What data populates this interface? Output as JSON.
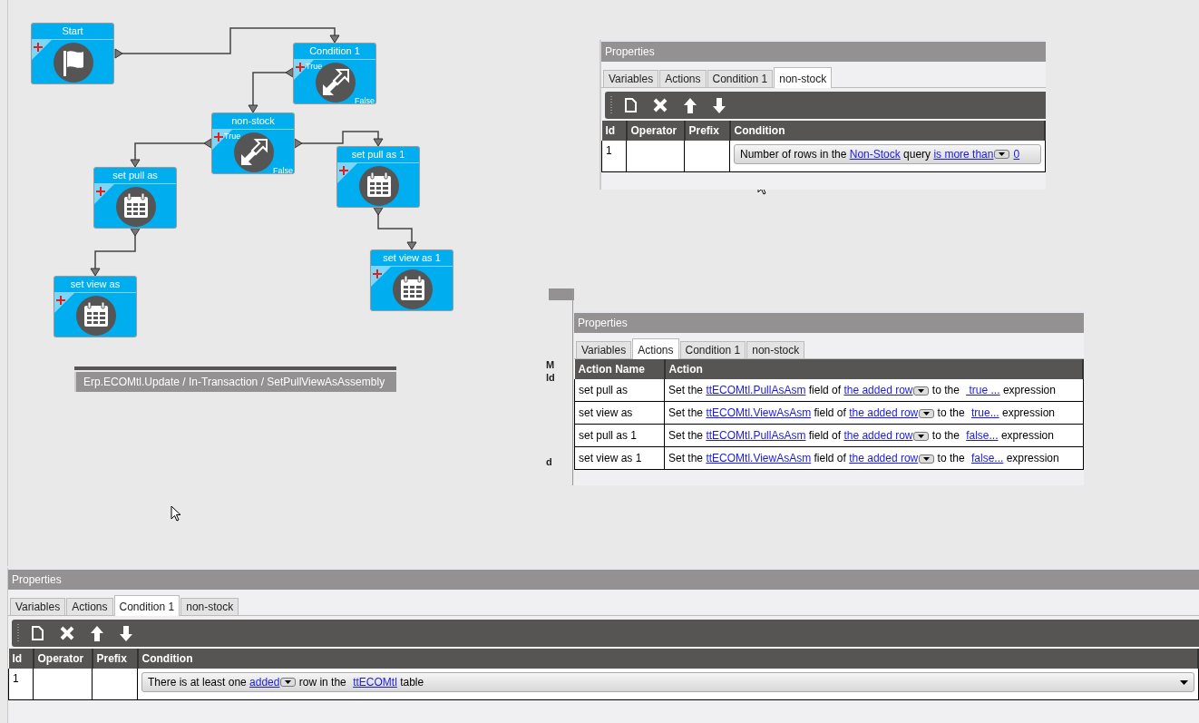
{
  "flow": {
    "nodes": [
      {
        "kind": "start",
        "title": "Start"
      },
      {
        "kind": "condition",
        "title": "Condition 1",
        "true_label": "True",
        "false_label": "False"
      },
      {
        "kind": "condition",
        "title": "non-stock",
        "true_label": "True",
        "false_label": "False"
      },
      {
        "kind": "action",
        "title": "set pull as"
      },
      {
        "kind": "action",
        "title": "set pull as 1"
      },
      {
        "kind": "action",
        "title": "set view as"
      },
      {
        "kind": "action",
        "title": "set view as 1"
      }
    ]
  },
  "breadcrumb": "Erp.ECOMtl.Update / In-Transaction / SetPullViewAsAssembly",
  "clipped_labels": [
    "M",
    "ld",
    "d"
  ],
  "panels": [
    {
      "kind": "condition",
      "title": "Properties",
      "tabs": [
        {
          "label": "Variables",
          "selected": false
        },
        {
          "label": "Actions",
          "selected": false
        },
        {
          "label": "Condition 1",
          "selected": false
        },
        {
          "label": "non-stock",
          "selected": true
        }
      ],
      "columns": [
        "Id",
        "Operator",
        "Prefix",
        "Condition"
      ],
      "rows": [
        {
          "id": "1",
          "segments": [
            {
              "kind": "text",
              "text": "Number of rows in the "
            },
            {
              "kind": "link",
              "text": "Non-Stock"
            },
            {
              "kind": "text",
              "text": " query "
            },
            {
              "kind": "link",
              "text": "is more than"
            },
            {
              "kind": "dropdown"
            },
            {
              "kind": "link",
              "text": "0"
            }
          ]
        }
      ]
    },
    {
      "kind": "actions",
      "title": "Properties",
      "tabs": [
        {
          "label": "Variables",
          "selected": false
        },
        {
          "label": "Actions",
          "selected": true
        },
        {
          "label": "Condition 1",
          "selected": false
        },
        {
          "label": "non-stock",
          "selected": false
        }
      ],
      "columns": [
        "Action Name",
        "Action"
      ],
      "rows": [
        {
          "name": "set pull as",
          "segments": [
            {
              "kind": "text",
              "text": "Set the "
            },
            {
              "kind": "link",
              "text": "ttECOMtl.PullAsAsm"
            },
            {
              "kind": "text",
              "text": " field of "
            },
            {
              "kind": "link",
              "text": "the added row"
            },
            {
              "kind": "dropdown"
            },
            {
              "kind": "text",
              "text": " to the "
            },
            {
              "kind": "link",
              "text": " true ..."
            },
            {
              "kind": "text",
              "text": " expression"
            }
          ]
        },
        {
          "name": "set view as",
          "segments": [
            {
              "kind": "text",
              "text": "Set the "
            },
            {
              "kind": "link",
              "text": "ttECOMtl.ViewAsAsm"
            },
            {
              "kind": "text",
              "text": " field of "
            },
            {
              "kind": "link",
              "text": "the added row"
            },
            {
              "kind": "dropdown"
            },
            {
              "kind": "text",
              "text": " to the "
            },
            {
              "kind": "link",
              "text": "true..."
            },
            {
              "kind": "text",
              "text": " expression"
            }
          ]
        },
        {
          "name": "set pull as 1",
          "segments": [
            {
              "kind": "text",
              "text": "Set the "
            },
            {
              "kind": "link",
              "text": "ttECOMtl.PullAsAsm"
            },
            {
              "kind": "text",
              "text": " field of "
            },
            {
              "kind": "link",
              "text": "the added row"
            },
            {
              "kind": "dropdown"
            },
            {
              "kind": "text",
              "text": " to the "
            },
            {
              "kind": "link",
              "text": "false..."
            },
            {
              "kind": "text",
              "text": " expression"
            }
          ]
        },
        {
          "name": "set view as 1",
          "segments": [
            {
              "kind": "text",
              "text": "Set the "
            },
            {
              "kind": "link",
              "text": "ttECOMtl.ViewAsAsm"
            },
            {
              "kind": "text",
              "text": " field of "
            },
            {
              "kind": "link",
              "text": "the added row"
            },
            {
              "kind": "dropdown"
            },
            {
              "kind": "text",
              "text": " to the "
            },
            {
              "kind": "link",
              "text": "false..."
            },
            {
              "kind": "text",
              "text": " expression"
            }
          ]
        }
      ]
    },
    {
      "kind": "condition",
      "title": "Properties",
      "tabs": [
        {
          "label": "Variables",
          "selected": false
        },
        {
          "label": "Actions",
          "selected": false
        },
        {
          "label": "Condition 1",
          "selected": true
        },
        {
          "label": "non-stock",
          "selected": false
        }
      ],
      "columns": [
        "Id",
        "Operator",
        "Prefix",
        "Condition"
      ],
      "rows": [
        {
          "id": "1",
          "segments": [
            {
              "kind": "text",
              "text": "There is at least one "
            },
            {
              "kind": "link",
              "text": "added"
            },
            {
              "kind": "dropdown"
            },
            {
              "kind": "text",
              "text": " row in the "
            },
            {
              "kind": "link",
              "text": "ttECOMtl"
            },
            {
              "kind": "text",
              "text": " table"
            }
          ]
        }
      ]
    }
  ]
}
